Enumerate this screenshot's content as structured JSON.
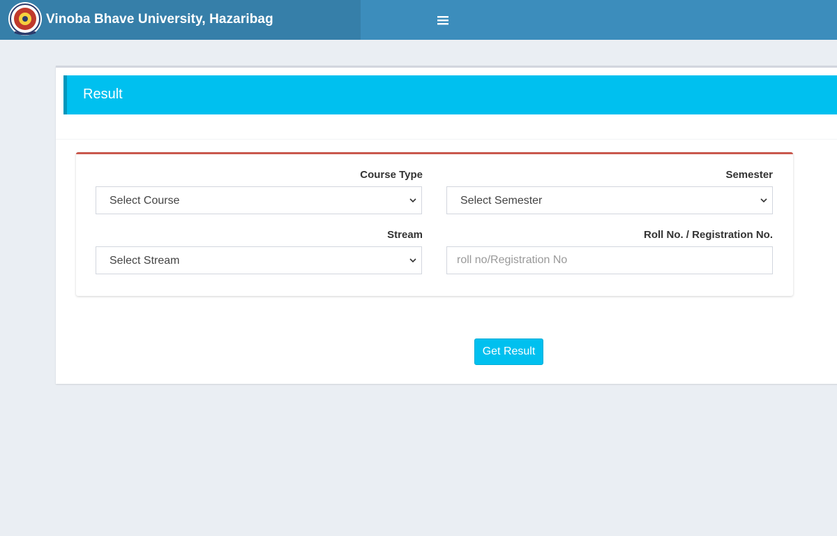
{
  "header": {
    "title": "Vinoba Bhave University, Hazaribag",
    "logo_icon": "university-seal-logo",
    "menu_icon": "hamburger-menu-icon",
    "bar_color": "#3c8dbc",
    "brand_color": "#367fa9"
  },
  "card": {
    "title": "Result",
    "header_color": "#00c0ef"
  },
  "form": {
    "course_type": {
      "label": "Course Type",
      "selected": "Select Course"
    },
    "semester": {
      "label": "Semester",
      "selected": "Select Semester"
    },
    "stream": {
      "label": "Stream",
      "selected": "Select Stream"
    },
    "roll_no": {
      "label": "Roll No. / Registration No.",
      "placeholder": "roll no/Registration No",
      "value": ""
    },
    "accent_color": "#c9584d"
  },
  "actions": {
    "submit_label": "Get Result"
  }
}
